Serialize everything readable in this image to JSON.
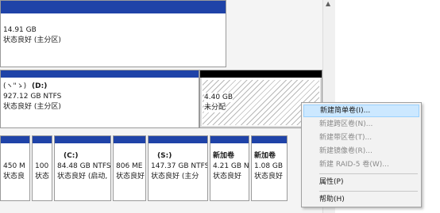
{
  "top_partial": {
    "size": "14.91 GB",
    "status": "状态良好 (主分区)"
  },
  "disk_row2": {
    "main": {
      "name_prefix": "(ヽ\"ゝ)",
      "name": "(D:)",
      "size_fs": "927.12 GB NTFS",
      "status": "状态良好 (主分区)"
    },
    "unalloc": {
      "size": "4.40 GB",
      "status": "未分配"
    }
  },
  "disk_row3": {
    "parts": [
      {
        "line1": "",
        "line2": "450 M",
        "line3": "状态良"
      },
      {
        "line1": "",
        "line2": "100",
        "line3": "状态"
      },
      {
        "line1": "(C:)",
        "line2": "84.48 GB NTFS",
        "line3": "状态良好 (启动,"
      },
      {
        "line1": "",
        "line2": "806 ME",
        "line3": "状态良好"
      },
      {
        "line1": "(S:)",
        "line2": "147.37 GB NTFS",
        "line3": "状态良好 (主分"
      },
      {
        "line1": "新加卷",
        "line2": "4.21 GB N",
        "line3": "状态良好"
      },
      {
        "line1": "新加卷",
        "line2": "1.08 GB",
        "line3": "状态良好"
      }
    ]
  },
  "context_menu": {
    "items": [
      {
        "label": "新建简单卷(I)...",
        "enabled": true,
        "highlighted": true
      },
      {
        "label": "新建跨区卷(N)...",
        "enabled": false
      },
      {
        "label": "新建带区卷(T)...",
        "enabled": false
      },
      {
        "label": "新建镜像卷(R)...",
        "enabled": false
      },
      {
        "label": "新建 RAID-5 卷(W)...",
        "enabled": false
      },
      {
        "label": "属性(P)",
        "enabled": true
      },
      {
        "label": "帮助(H)",
        "enabled": true
      }
    ]
  },
  "colors": {
    "primary_bar": "#1f43a8",
    "unallocated_bar": "#000000",
    "menu_highlight": "#cce8ff"
  }
}
